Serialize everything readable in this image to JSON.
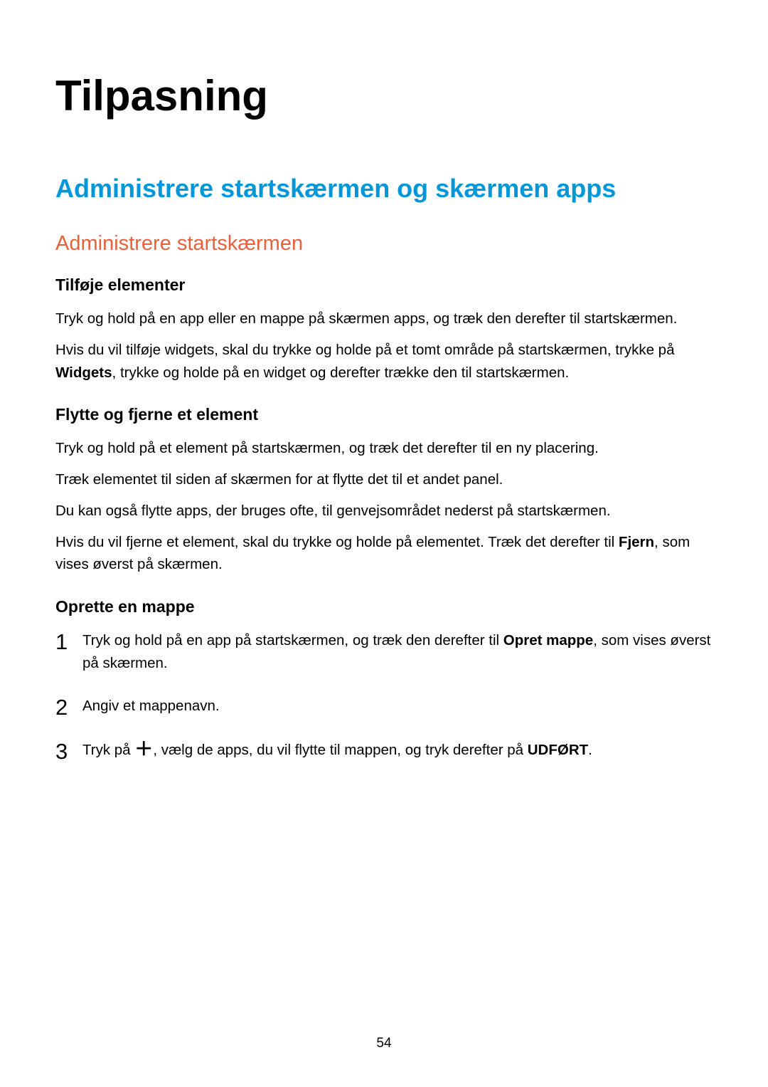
{
  "page": {
    "title": "Tilpasning",
    "section_title": "Administrere startskærmen og skærmen apps",
    "subsection_title": "Administrere startskærmen",
    "blocks": {
      "tilfoje": {
        "heading": "Tilføje elementer",
        "p1": "Tryk og hold på en app eller en mappe på skærmen apps, og træk den derefter til startskærmen.",
        "p2_a": "Hvis du vil tilføje widgets, skal du trykke og holde på et tomt område på startskærmen, trykke på ",
        "p2_bold": "Widgets",
        "p2_b": ", trykke og holde på en widget og derefter trække den til startskærmen."
      },
      "flytte": {
        "heading": "Flytte og fjerne et element",
        "p1": "Tryk og hold på et element på startskærmen, og træk det derefter til en ny placering.",
        "p2": "Træk elementet til siden af skærmen for at flytte det til et andet panel.",
        "p3": "Du kan også flytte apps, der bruges ofte, til genvejsområdet nederst på startskærmen.",
        "p4_a": "Hvis du vil fjerne et element, skal du trykke og holde på elementet. Træk det derefter til ",
        "p4_bold": "Fjern",
        "p4_b": ", som vises øverst på skærmen."
      },
      "oprette": {
        "heading": "Oprette en mappe",
        "steps": {
          "s1_num": "1",
          "s1_a": "Tryk og hold på en app på startskærmen, og træk den derefter til ",
          "s1_bold": "Opret mappe",
          "s1_b": ", som vises øverst på skærmen.",
          "s2_num": "2",
          "s2_text": "Angiv et mappenavn.",
          "s3_num": "3",
          "s3_a": "Tryk på ",
          "s3_icon": "＋",
          "s3_b": ", vælg de apps, du vil flytte til mappen, og tryk derefter på ",
          "s3_bold": "UDFØRT",
          "s3_c": "."
        }
      }
    },
    "page_number": "54"
  }
}
